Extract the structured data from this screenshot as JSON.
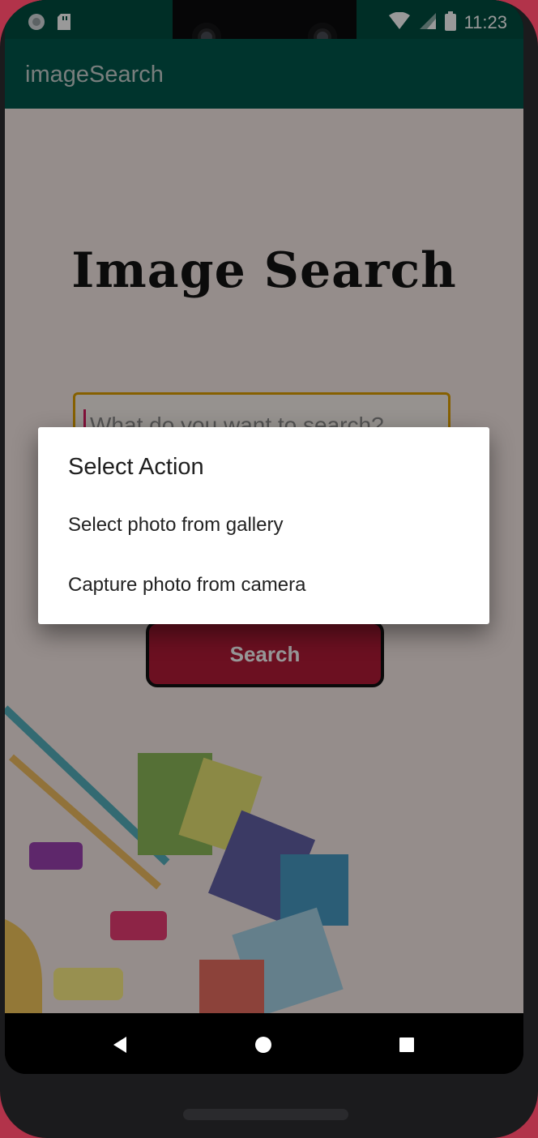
{
  "status_bar": {
    "time": "11:23",
    "left_icons": [
      "aperture-icon",
      "sd-card-icon"
    ],
    "right_icons": [
      "wifi-icon",
      "signal-icon",
      "battery-icon"
    ]
  },
  "app_bar": {
    "title": "imageSearch"
  },
  "main": {
    "hero_title": "Image Search",
    "search_placeholder": "What do you want to search?",
    "search_button_label": "Search"
  },
  "dialog": {
    "title": "Select Action",
    "items": [
      {
        "label": "Select photo from gallery"
      },
      {
        "label": "Capture photo from camera"
      }
    ]
  },
  "colors": {
    "status_bar": "#004d40",
    "app_bar": "#00574b",
    "accent_border": "#e0a000",
    "button": "#b51b38"
  },
  "nav_bar": {
    "icons": [
      "back-icon",
      "home-icon",
      "recents-icon"
    ]
  }
}
